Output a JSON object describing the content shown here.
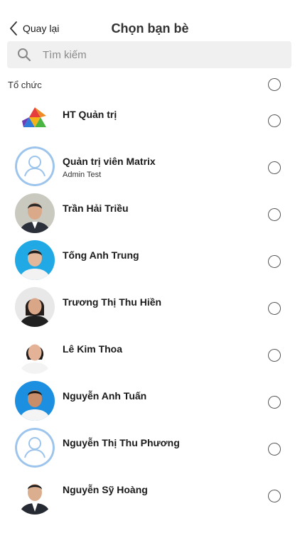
{
  "header": {
    "back_label": "Quay lại",
    "title": "Chọn bạn bè"
  },
  "search": {
    "placeholder": "Tìm kiếm",
    "value": ""
  },
  "organization": {
    "label": "Tổ chức"
  },
  "contacts": [
    {
      "name": "HT Quản trị",
      "subtitle": "",
      "avatar": "logo"
    },
    {
      "name": "Quản trị viên Matrix",
      "subtitle": "Admin Test",
      "avatar": "placeholder"
    },
    {
      "name": "Trần Hải Triều",
      "subtitle": "",
      "avatar": "photo"
    },
    {
      "name": "Tống Anh Trung",
      "subtitle": "",
      "avatar": "photo"
    },
    {
      "name": "Trương Thị Thu Hiền",
      "subtitle": "",
      "avatar": "photo"
    },
    {
      "name": "Lê Kim Thoa",
      "subtitle": "",
      "avatar": "photo"
    },
    {
      "name": "Nguyễn Anh Tuấn",
      "subtitle": "",
      "avatar": "photo"
    },
    {
      "name": "Nguyễn Thị Thu Phương",
      "subtitle": "",
      "avatar": "placeholder"
    },
    {
      "name": "Nguyễn Sỹ Hoàng",
      "subtitle": "",
      "avatar": "photo"
    }
  ],
  "colors": {
    "radio_border": "#555555",
    "placeholder_avatar": "#9cc4ec",
    "search_bg": "#f0f0f0"
  }
}
